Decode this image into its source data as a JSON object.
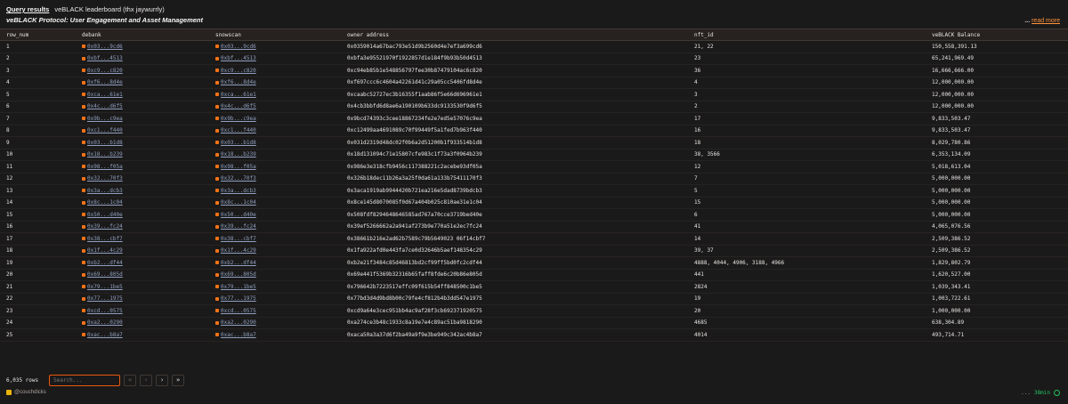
{
  "header": {
    "query_results": "Query results",
    "title": "veBLACK leaderboard (thx jaywurrly)",
    "subtitle": "veBLACK Protocol: User Engagement and Asset Management",
    "read_more_prefix": "... ",
    "read_more": "read more"
  },
  "table": {
    "columns": [
      "row_num",
      "debank",
      "snowscan",
      "owner address",
      "nft_id",
      "veBLACK Balance"
    ],
    "rows": [
      [
        "1",
        "0x03...9cd6",
        "0x03...9cd6",
        "0x0359014a67bac793e51d9b2560d4e7ef3a699cd6",
        "21, 22",
        "150,558,391.13"
      ],
      [
        "2",
        "0xbf...4513",
        "0xbf...4513",
        "0xbfa3e95521970f1922857d1e184f9b93b50d4513",
        "23",
        "65,241,969.49"
      ],
      [
        "3",
        "0xc9...c820",
        "0xc9...c820",
        "0xc94eb85b1e548856797fee30b87479104ac6c820",
        "36",
        "16,666,666.00"
      ],
      [
        "4",
        "0xf6...8d4e",
        "0xf6...8d4e",
        "0xf697ccc6c4604a42261d41c29a05cc5406fd8d4e",
        "4",
        "12,000,000.00"
      ],
      [
        "5",
        "0xca...61e1",
        "0xca...61e1",
        "0xcaabc52727ec3b16355f1aab86f5e66d696961e1",
        "3",
        "12,000,000.00"
      ],
      [
        "6",
        "0x4c...d6f5",
        "0x4c...d6f5",
        "0x4cb3bbfd6d8ae6a190109b633dc9133530f9d6f5",
        "2",
        "12,000,000.00"
      ],
      [
        "7",
        "0x9b...c9ea",
        "0x9b...c9ea",
        "0x9bcd74393c3cee18867234fe2e7ed5e57076c9ea",
        "17",
        "9,833,503.47"
      ],
      [
        "8",
        "0xc1...f440",
        "0xc1...f440",
        "0xc12499aa4691089c70f99449f5a1fed7b963f440",
        "16",
        "9,833,503.47"
      ],
      [
        "9",
        "0x03...b1d8",
        "0x03...b1d8",
        "0x031d2319d48dc02f0b6a2d51200b1f933514b1d8",
        "18",
        "8,029,780.86"
      ],
      [
        "10",
        "0x18...b239",
        "0x18...b239",
        "0x18d131094c71e15807cfe983c1f73a3f0964b239",
        "38, 3566",
        "6,353,134.09"
      ],
      [
        "11",
        "0x98...f05a",
        "0x98...f05a",
        "0x986e3e318cfb9456c117388221c2acebe93df05a",
        "12",
        "5,018,613.04"
      ],
      [
        "12",
        "0x32...70f3",
        "0x32...70f3",
        "0x326b18dec11b26a3a25f0da61a133b75411170f3",
        "7",
        "5,000,000.00"
      ],
      [
        "13",
        "0x3a...dcb3",
        "0x3a...dcb3",
        "0x3aca1919ab9944420b721ea216e5dad8739bdcb3",
        "5",
        "5,000,000.00"
      ],
      [
        "14",
        "0x8c...1c04",
        "0x8c...1c04",
        "0x8ce145d8070085f0d67a404b025c810ae31e1c04",
        "15",
        "5,000,000.00"
      ],
      [
        "15",
        "0x50...d40e",
        "0x50...d40e",
        "0x508fdf8294648646585ad767a70cce3719bed40e",
        "6",
        "5,000,000.00"
      ],
      [
        "16",
        "0x39...fc24",
        "0x39...fc24",
        "0x39ef5266662a2a941af273b9e770a51e2ec7fc24",
        "41",
        "4,065,076.56"
      ],
      [
        "17",
        "0x38...cbf7",
        "0x38...cbf7",
        "0x38661b216e2ad62b7589c79b5649023 06f14cbf7",
        "14",
        "2,509,386.52"
      ],
      [
        "18",
        "0x1f...4c29",
        "0x1f...4c29",
        "0x1fa922afd0e443fa7ce0d32646b5aef148354c29",
        "39, 37",
        "2,509,386.52"
      ],
      [
        "19",
        "0xb2...df44",
        "0xb2...df44",
        "0xb2e21f3484c85d46813bd2cf99ff5bd0fc2cdf44",
        "4888, 4044, 4906, 3188, 4966",
        "1,829,802.79"
      ],
      [
        "20",
        "0x69...805d",
        "0x69...805d",
        "0x69e441f5369b32316b65faff8fde6c20b86e805d",
        "441",
        "1,620,527.00"
      ],
      [
        "21",
        "0x79...1be5",
        "0x79...1be5",
        "0x796642b7223517effc09f615b54ff848500c1be5",
        "2824",
        "1,039,343.41"
      ],
      [
        "22",
        "0x77...1975",
        "0x77...1975",
        "0x77bd3d4d9bd8b00c79fe4cf812b4b3dd547e1975",
        "19",
        "1,003,722.61"
      ],
      [
        "23",
        "0xcd...0575",
        "0xcd...0575",
        "0xcd9a64e3cec951bb4ac9af28f3cb692371920575",
        "20",
        "1,000,000.00"
      ],
      [
        "24",
        "0xa2...0290",
        "0xa2...0290",
        "0xa274ce3b48c1933c8a19e7e4c89ac51ba9818290",
        "4685",
        "638,304.89"
      ],
      [
        "25",
        "0xac...b8a7",
        "0xac...b8a7",
        "0xaca50a3a37d6f2ba49a9f9e3be949c342ac4b8a7",
        "4014",
        "493,714.71"
      ]
    ]
  },
  "footer": {
    "row_count": "6,035 rows",
    "search_placeholder": "Search...",
    "first_icon": "double-chevron-left-icon",
    "prev_icon": "chevron-left-icon",
    "next_icon": "chevron-right-icon",
    "last_icon": "double-chevron-right-icon",
    "pg_first": "«",
    "pg_prev": "‹",
    "pg_next": "›",
    "pg_last": "»",
    "author": "@couchdicks",
    "age_prefix": "...",
    "age": "38min"
  },
  "colors": {
    "accent": "#f97316",
    "link": "#8f9fbf",
    "fresh": "#22c55e"
  }
}
